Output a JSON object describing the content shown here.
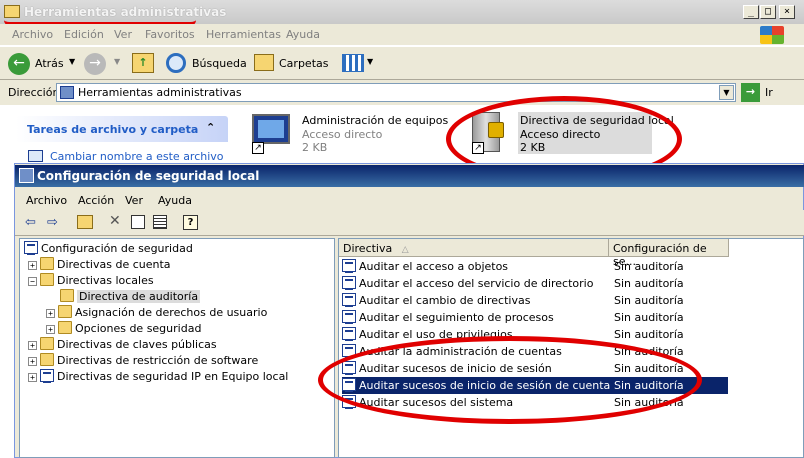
{
  "explorer": {
    "title": "Herramientas administrativas",
    "menu": [
      "Archivo",
      "Edición",
      "Ver",
      "Favoritos",
      "Herramientas",
      "Ayuda"
    ],
    "toolbar": {
      "back": "Atrás",
      "search": "Búsqueda",
      "folders": "Carpetas"
    },
    "address": {
      "label": "Dirección",
      "value": "Herramientas administrativas",
      "go": "Ir"
    },
    "tasks": {
      "header": "Tareas de archivo y carpeta",
      "item": "Cambiar nombre a este archivo"
    },
    "files": [
      {
        "name": "Administración de equipos",
        "type": "Acceso directo",
        "size": "2 KB"
      },
      {
        "name": "Directiva de seguridad local",
        "type": "Acceso directo",
        "size": "2 KB"
      }
    ]
  },
  "mmc": {
    "title": "Configuración de seguridad local",
    "menu": [
      "Archivo",
      "Acción",
      "Ver",
      "Ayuda"
    ],
    "tree": [
      "Configuración de seguridad",
      "Directivas de cuenta",
      "Directivas locales",
      "Directiva de auditoría",
      "Asignación de derechos de usuario",
      "Opciones de seguridad",
      "Directivas de claves públicas",
      "Directivas de restricción de software",
      "Directivas de seguridad IP en Equipo local"
    ],
    "columns": {
      "policy": "Directiva",
      "setting": "Configuración de se..."
    },
    "rows": [
      {
        "policy": "Auditar el acceso a objetos",
        "setting": "Sin auditoría"
      },
      {
        "policy": "Auditar el acceso del servicio de directorio",
        "setting": "Sin auditoría"
      },
      {
        "policy": "Auditar el cambio de directivas",
        "setting": "Sin auditoría"
      },
      {
        "policy": "Auditar el seguimiento de procesos",
        "setting": "Sin auditoría"
      },
      {
        "policy": "Auditar el uso de privilegios",
        "setting": "Sin auditoría"
      },
      {
        "policy": "Auditar la administración de cuentas",
        "setting": "Sin auditoría"
      },
      {
        "policy": "Auditar sucesos de inicio de sesión",
        "setting": "Sin auditoría"
      },
      {
        "policy": "Auditar sucesos de inicio de sesión de cuenta",
        "setting": "Sin auditoría"
      },
      {
        "policy": "Auditar sucesos del sistema",
        "setting": "Sin auditoría"
      }
    ]
  },
  "colors": {
    "annotation": "#e00000",
    "selection": "#0a246a",
    "titlebar": "#0a246a"
  }
}
